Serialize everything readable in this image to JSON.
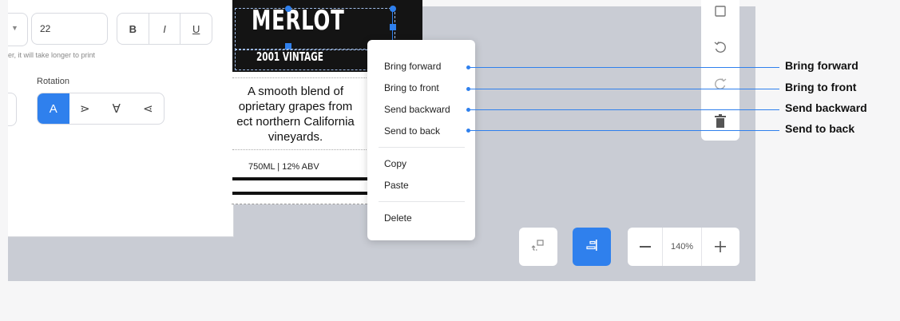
{
  "properties_panel": {
    "font_size_value": "22",
    "format_buttons": {
      "bold": "B",
      "italic": "I",
      "underline": "U"
    },
    "hint_text": "er, it will take longer to print",
    "rotation_label": "Rotation",
    "rotation_options": [
      "A",
      "⋗",
      "∀",
      "⋖"
    ],
    "rotation_selected": "A"
  },
  "wine_label": {
    "title": "MERLOT",
    "vintage": "2001 VINTAGE",
    "description_lines": [
      "A smooth blend of",
      "oprietary grapes from",
      "ect northern California",
      "vineyards."
    ],
    "bottle_info": "750ML | 12% ABV"
  },
  "context_menu": {
    "group1": [
      "Bring forward",
      "Bring to front",
      "Send backward",
      "Send to back"
    ],
    "group2": [
      "Copy",
      "Paste"
    ],
    "group3": [
      "Delete"
    ]
  },
  "annotations": [
    "Bring forward",
    "Bring to front",
    "Send backward",
    "Send to back"
  ],
  "vertical_toolbar": {
    "icons": [
      "copy-icon",
      "undo-icon",
      "redo-icon",
      "trash-icon"
    ]
  },
  "bottom_toolbar": {
    "zoom_level": "140%",
    "icons": [
      "transform-icon",
      "align-icon",
      "zoom-out-icon",
      "zoom-in-icon"
    ]
  },
  "colors": {
    "accent": "#2f80ed",
    "canvas": "#c9ccd4",
    "panel": "#ffffff"
  }
}
